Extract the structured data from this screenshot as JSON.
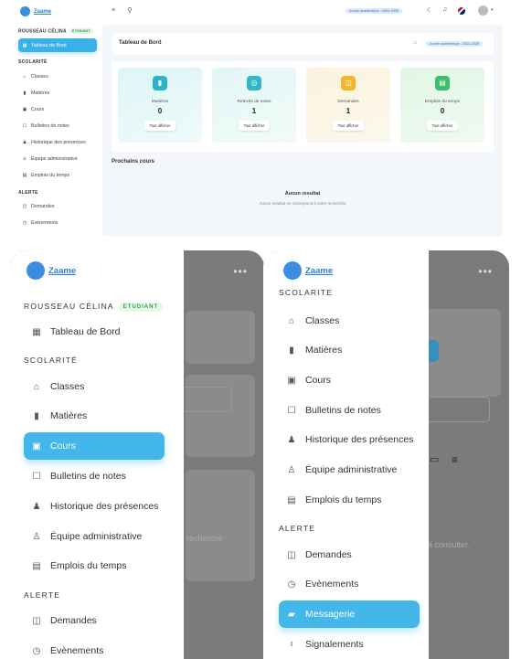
{
  "app": {
    "name": "Zaame"
  },
  "colors": {
    "accent": "#3ab1e8",
    "brand": "#2b7fd8",
    "green_badge": "#27a046"
  },
  "desktop": {
    "user_section": "ROUSSEAU CÉLINA",
    "role_badge": "ETUDIANT",
    "sidebar": [
      {
        "label": "Tableau de Bord",
        "icon": "dashboard-icon",
        "active": true
      },
      {
        "section": "SCOLARITÉ"
      },
      {
        "label": "Classes",
        "icon": "school-icon"
      },
      {
        "label": "Matières",
        "icon": "book-icon"
      },
      {
        "label": "Cours",
        "icon": "course-icon"
      },
      {
        "label": "Bulletins de notes",
        "icon": "report-icon"
      },
      {
        "label": "Historique des présences",
        "icon": "attendance-icon"
      },
      {
        "label": "Équipe administrative",
        "icon": "team-icon"
      },
      {
        "label": "Emplois du temps",
        "icon": "calendar-icon"
      },
      {
        "section": "ALERTE"
      },
      {
        "label": "Demandes",
        "icon": "request-icon"
      },
      {
        "label": "Evènements",
        "icon": "event-icon"
      }
    ],
    "topbar": {
      "year_badge": "Année académique : 2024-2025"
    },
    "header": {
      "title": "Tableau de Bord",
      "year_badge": "Année académique : 2024-2025"
    },
    "stats": [
      {
        "label": "Matières",
        "value": "0",
        "button": "Tout afficher",
        "color": "#2bb6c8",
        "icon": "book-icon"
      },
      {
        "label": "Relevés de notes",
        "value": "1",
        "button": "Tout afficher",
        "color": "#31b7c9",
        "icon": "grades-icon"
      },
      {
        "label": "Demandes",
        "value": "1",
        "button": "Tout afficher",
        "color": "#f3b52a",
        "icon": "request-icon"
      },
      {
        "label": "Emplois du temps",
        "value": "0",
        "button": "Tout afficher",
        "color": "#3cbf6a",
        "icon": "calendar-icon"
      }
    ],
    "next_courses": "Prochains cours",
    "no_result_title": "Aucun resultat",
    "no_result_text": "Aucun resultat ne correspond à votre recherche"
  },
  "mobile_left": {
    "user_section": "ROUSSEAU CÉLINA",
    "role_badge": "ETUDIANT",
    "section_scolarite": "SCOLARITÉ",
    "section_alerte": "ALERTE",
    "items": [
      "Tableau de Bord",
      "Classes",
      "Matières",
      "Cours",
      "Bulletins de notes",
      "Historique des présences",
      "Équipe administrative",
      "Emplois du temps",
      "Demandes",
      "Evènements"
    ],
    "behind_text": "tre recherche"
  },
  "mobile_right": {
    "section_scolarite": "SCOLARITÉ",
    "section_alerte": "ALERTE",
    "items": [
      "Classes",
      "Matières",
      "Cours",
      "Bulletins de notes",
      "Historique des présences",
      "Équipe administrative",
      "Emplois du temps",
      "Demandes",
      "Evènements",
      "Messagerie",
      "Signalements"
    ],
    "behind_text": "à consulter.",
    "behind_letter": "e"
  }
}
